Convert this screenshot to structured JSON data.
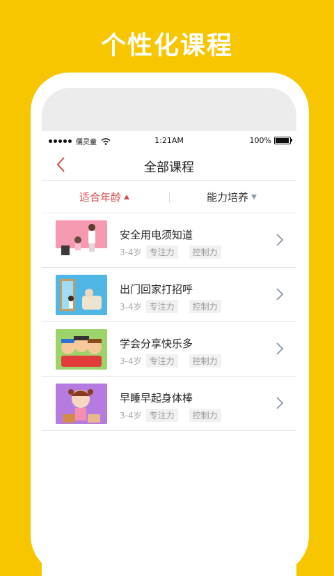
{
  "hero": {
    "title": "个性化课程"
  },
  "statusbar": {
    "carrier": "儒灵童",
    "time": "1:21AM",
    "battery": "100%"
  },
  "nav": {
    "title": "全部课程"
  },
  "filters": {
    "age_label": "适合年龄",
    "ability_label": "能力培养"
  },
  "courses": [
    {
      "title": "安全用电须知道",
      "age": "3-4岁",
      "tags": [
        "专注力",
        "控制力"
      ]
    },
    {
      "title": "出门回家打招呼",
      "age": "3-4岁",
      "tags": [
        "专注力",
        "控制力"
      ]
    },
    {
      "title": "学会分享快乐多",
      "age": "3-4岁",
      "tags": [
        "专注力",
        "控制力"
      ]
    },
    {
      "title": "早睡早起身体棒",
      "age": "3-4岁",
      "tags": [
        "专注力",
        "控制力"
      ]
    }
  ],
  "colors": {
    "background": "#F7C600",
    "accent": "#D24B4B"
  }
}
